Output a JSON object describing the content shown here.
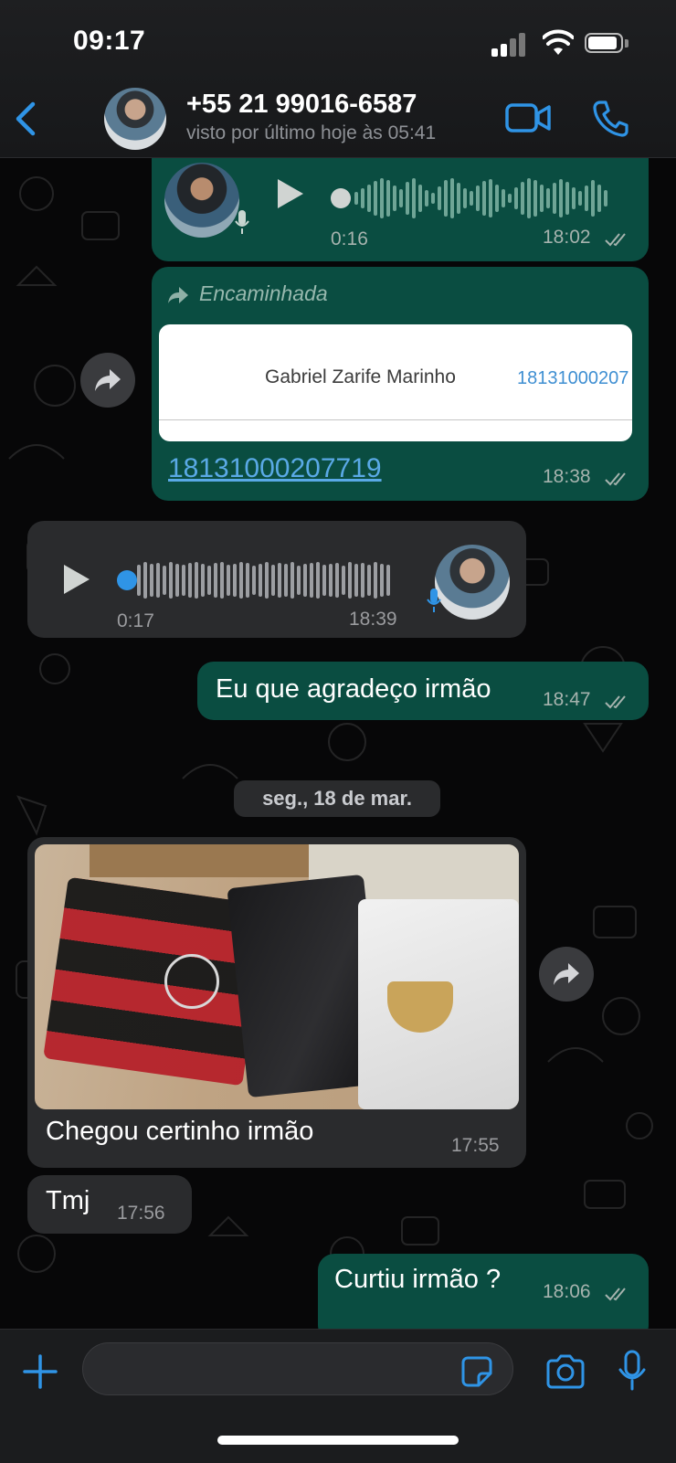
{
  "status_bar": {
    "time": "09:17"
  },
  "header": {
    "contact_name": "+55 21 99016-6587",
    "last_seen": "visto por último hoje às 05:41"
  },
  "messages": {
    "audio_out": {
      "duration": "0:16",
      "time": "18:02"
    },
    "forwarded": {
      "label": "Encaminhada",
      "card_name": "Gabriel Zarife Marinho",
      "card_code": "18131000207",
      "link": "18131000207719",
      "time": "18:38"
    },
    "audio_in": {
      "duration": "0:17",
      "time": "18:39"
    },
    "text_out_1": {
      "text": "Eu que agradeço irmão",
      "time": "18:47"
    },
    "date_separator": "seg., 18 de mar.",
    "photo_in": {
      "caption": "Chegou certinho irmão",
      "time": "17:55"
    },
    "text_in_1": {
      "text": "Tmj",
      "time": "17:56"
    },
    "text_out_2": {
      "text": "Curtiu irmão ?",
      "time": "18:06"
    }
  },
  "colors": {
    "accent": "#2f94e6",
    "outgoing_bubble": "#0a4d41",
    "incoming_bubble": "#2a2b2d",
    "link": "#5aa9e6"
  }
}
